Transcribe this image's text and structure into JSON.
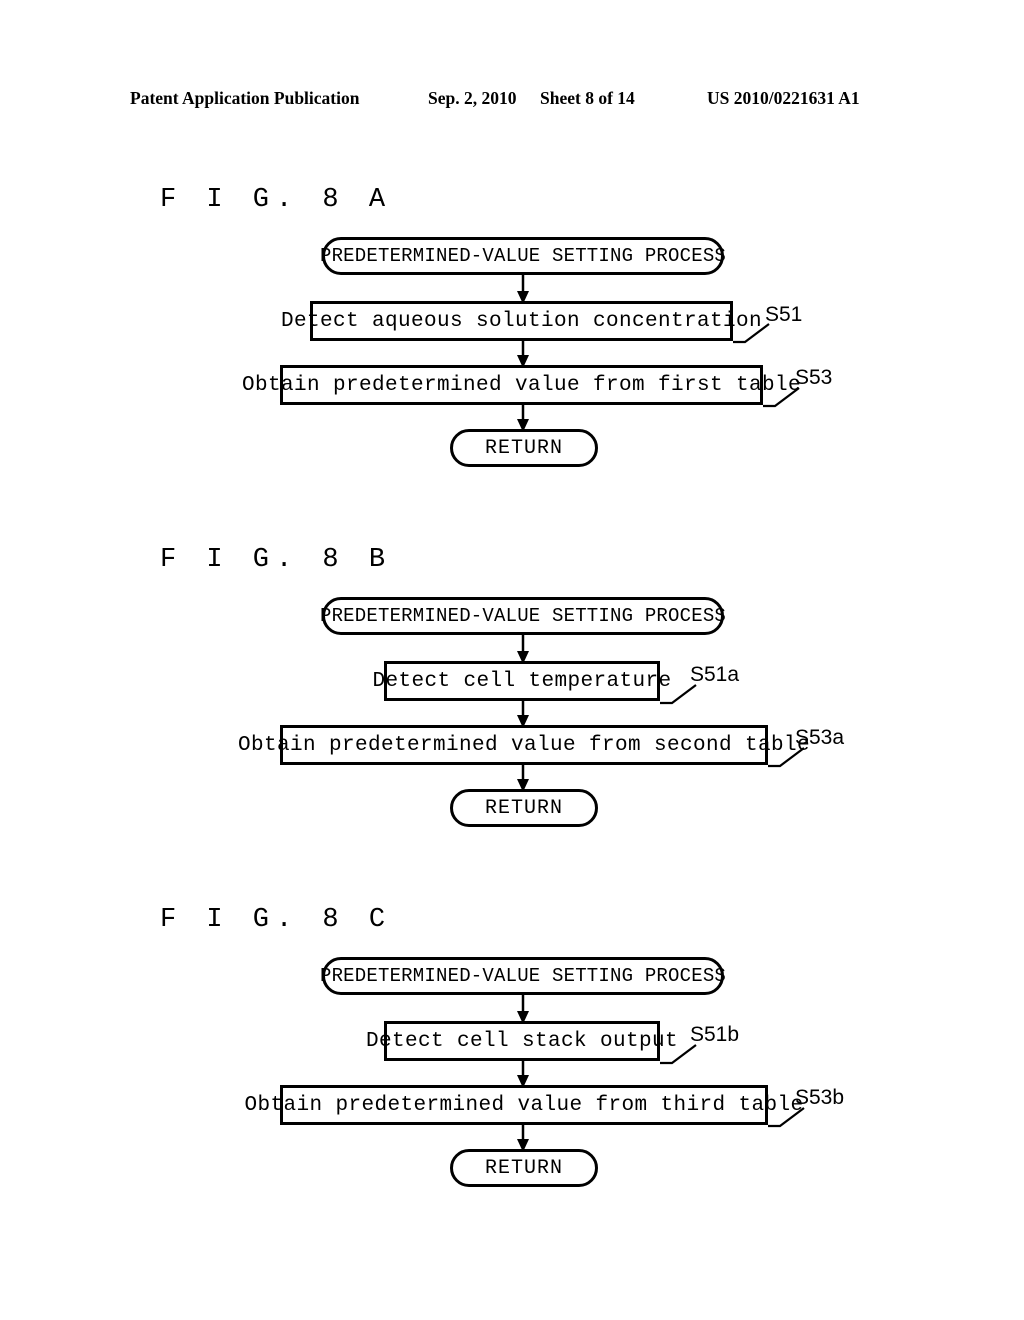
{
  "header": {
    "publication": "Patent Application Publication",
    "date": "Sep. 2, 2010",
    "sheet": "Sheet 8 of 14",
    "patent_number": "US 2010/0221631 A1"
  },
  "figures": [
    {
      "id": "8a",
      "label": "F I G.  8 A",
      "start_label": "PREDETERMINED-VALUE SETTING PROCESS",
      "step1_label": "Detect aqueous solution concentration",
      "step1_ref": "S51",
      "step2_label": "Obtain predetermined value from first table",
      "step2_ref": "S53",
      "end_label": "RETURN"
    },
    {
      "id": "8b",
      "label": "F I G.  8 B",
      "start_label": "PREDETERMINED-VALUE SETTING PROCESS",
      "step1_label": "Detect cell temperature",
      "step1_ref": "S51a",
      "step2_label": "Obtain predetermined value from second table",
      "step2_ref": "S53a",
      "end_label": "RETURN"
    },
    {
      "id": "8c",
      "label": "F I G.  8 C",
      "start_label": "PREDETERMINED-VALUE SETTING PROCESS",
      "step1_label": "Detect cell stack output",
      "step1_ref": "S51b",
      "step2_label": "Obtain predetermined value from third table",
      "step2_ref": "S53b",
      "end_label": "RETURN"
    }
  ],
  "colors": {
    "ink": "#000000",
    "paper": "#ffffff"
  }
}
